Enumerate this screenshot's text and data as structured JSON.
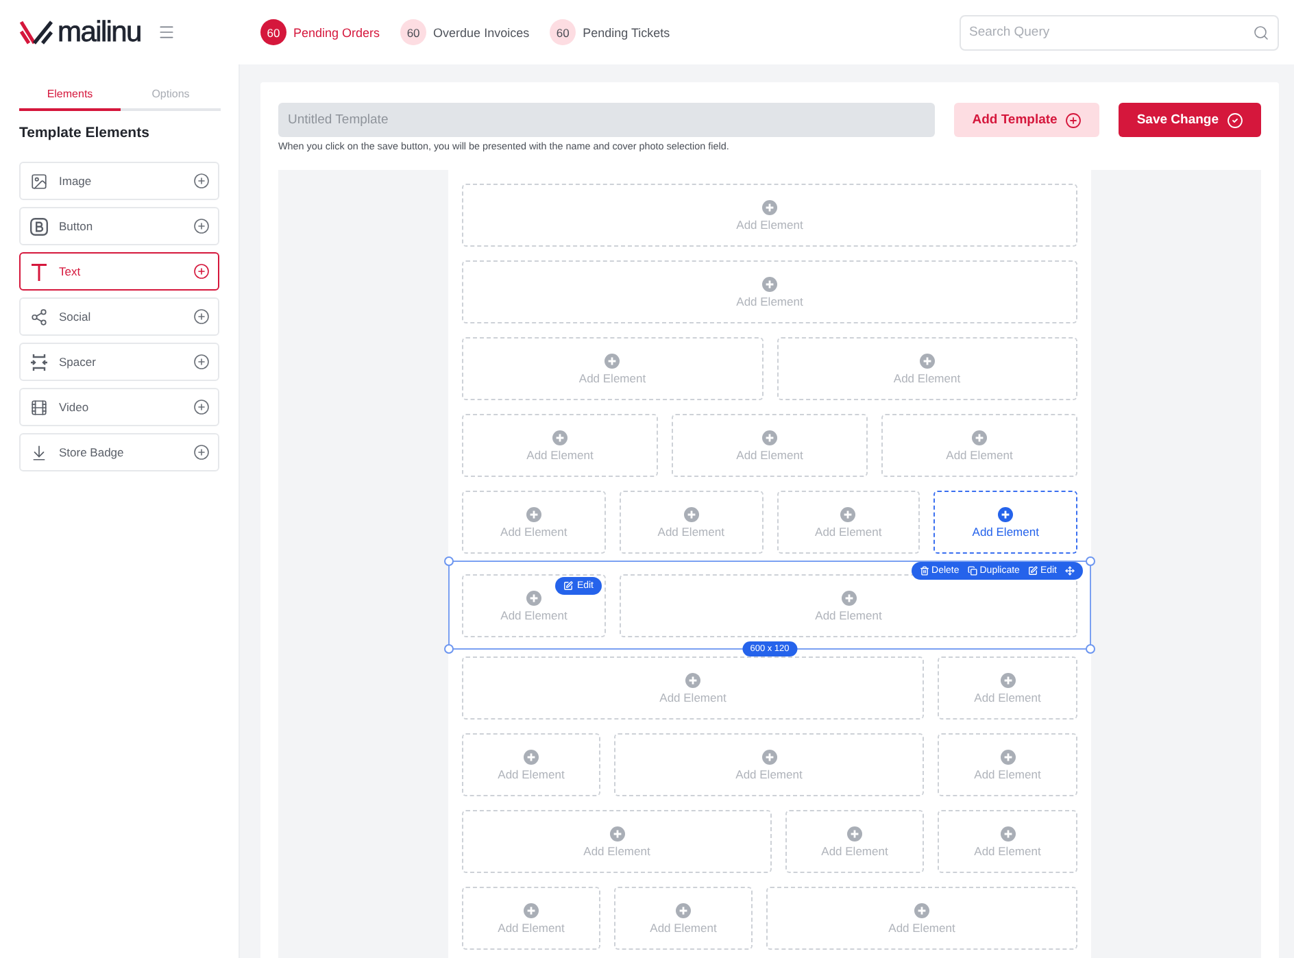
{
  "header": {
    "logo": "mailinu",
    "badges": [
      {
        "count": "60",
        "label": "Pending Orders",
        "selected": true
      },
      {
        "count": "60",
        "label": "Overdue Invoices",
        "selected": false
      },
      {
        "count": "60",
        "label": "Pending Tickets",
        "selected": false
      }
    ],
    "search": {
      "placeholder": "Search Query"
    }
  },
  "sidebar": {
    "tabs": [
      {
        "label": "Elements",
        "selected": true
      },
      {
        "label": "Options",
        "selected": false
      }
    ],
    "title": "Template Elements",
    "items": [
      {
        "label": "Image",
        "selected": false
      },
      {
        "label": "Button",
        "selected": false
      },
      {
        "label": "Text",
        "selected": true
      },
      {
        "label": "Social",
        "selected": false
      },
      {
        "label": "Spacer",
        "selected": false
      },
      {
        "label": "Video",
        "selected": false
      },
      {
        "label": "Store Badge",
        "selected": false
      }
    ]
  },
  "editor": {
    "name_field": {
      "placeholder": "Untitled Template"
    },
    "hint": "When you click on the save button, you will be presented with the name and cover photo selection field.",
    "buttons": [
      {
        "label": "Add Template",
        "kind": "secondary"
      },
      {
        "label": "Save Change",
        "kind": "primary"
      }
    ],
    "canvas": {
      "sections": [
        {
          "selected": false,
          "slots": [
            {
              "label": "Add Element",
              "selected": false
            }
          ]
        },
        {
          "selected": false,
          "slots": [
            {
              "label": "Add Element",
              "selected": false
            }
          ]
        },
        {
          "selected": false,
          "slots": [
            {
              "label": "Add Element",
              "selected": false
            },
            {
              "label": "Add Element",
              "selected": false
            }
          ]
        },
        {
          "selected": false,
          "slots": [
            {
              "label": "Add Element",
              "selected": false
            },
            {
              "label": "Add Element",
              "selected": false
            },
            {
              "label": "Add Element",
              "selected": false
            }
          ]
        },
        {
          "selected": false,
          "slots": [
            {
              "label": "Add Element",
              "selected": false
            },
            {
              "label": "Add Element",
              "selected": false
            },
            {
              "label": "Add Element",
              "selected": false
            },
            {
              "label": "Add Element",
              "selected": true
            }
          ]
        },
        {
          "selected": true,
          "toolbar": [
            "Delete",
            "Duplicate",
            "Edit"
          ],
          "size": "600 x 120",
          "slots": [
            {
              "label": "Add Element",
              "selected": false,
              "badge": "Edit"
            },
            {
              "label": "Add Element",
              "selected": false
            }
          ]
        },
        {
          "selected": false,
          "slots": [
            {
              "label": "Add Element",
              "selected": false
            },
            {
              "label": "Add Element",
              "selected": false
            }
          ]
        },
        {
          "selected": false,
          "slots": [
            {
              "label": "Add Element",
              "selected": false
            },
            {
              "label": "Add Element",
              "selected": false
            },
            {
              "label": "Add Element",
              "selected": false
            }
          ]
        },
        {
          "selected": false,
          "slots": [
            {
              "label": "Add Element",
              "selected": false
            },
            {
              "label": "Add Element",
              "selected": false
            },
            {
              "label": "Add Element",
              "selected": false
            }
          ]
        },
        {
          "selected": false,
          "slots": [
            {
              "label": "Add Element",
              "selected": false
            },
            {
              "label": "Add Element",
              "selected": false
            },
            {
              "label": "Add Element",
              "selected": false
            }
          ]
        }
      ]
    }
  }
}
